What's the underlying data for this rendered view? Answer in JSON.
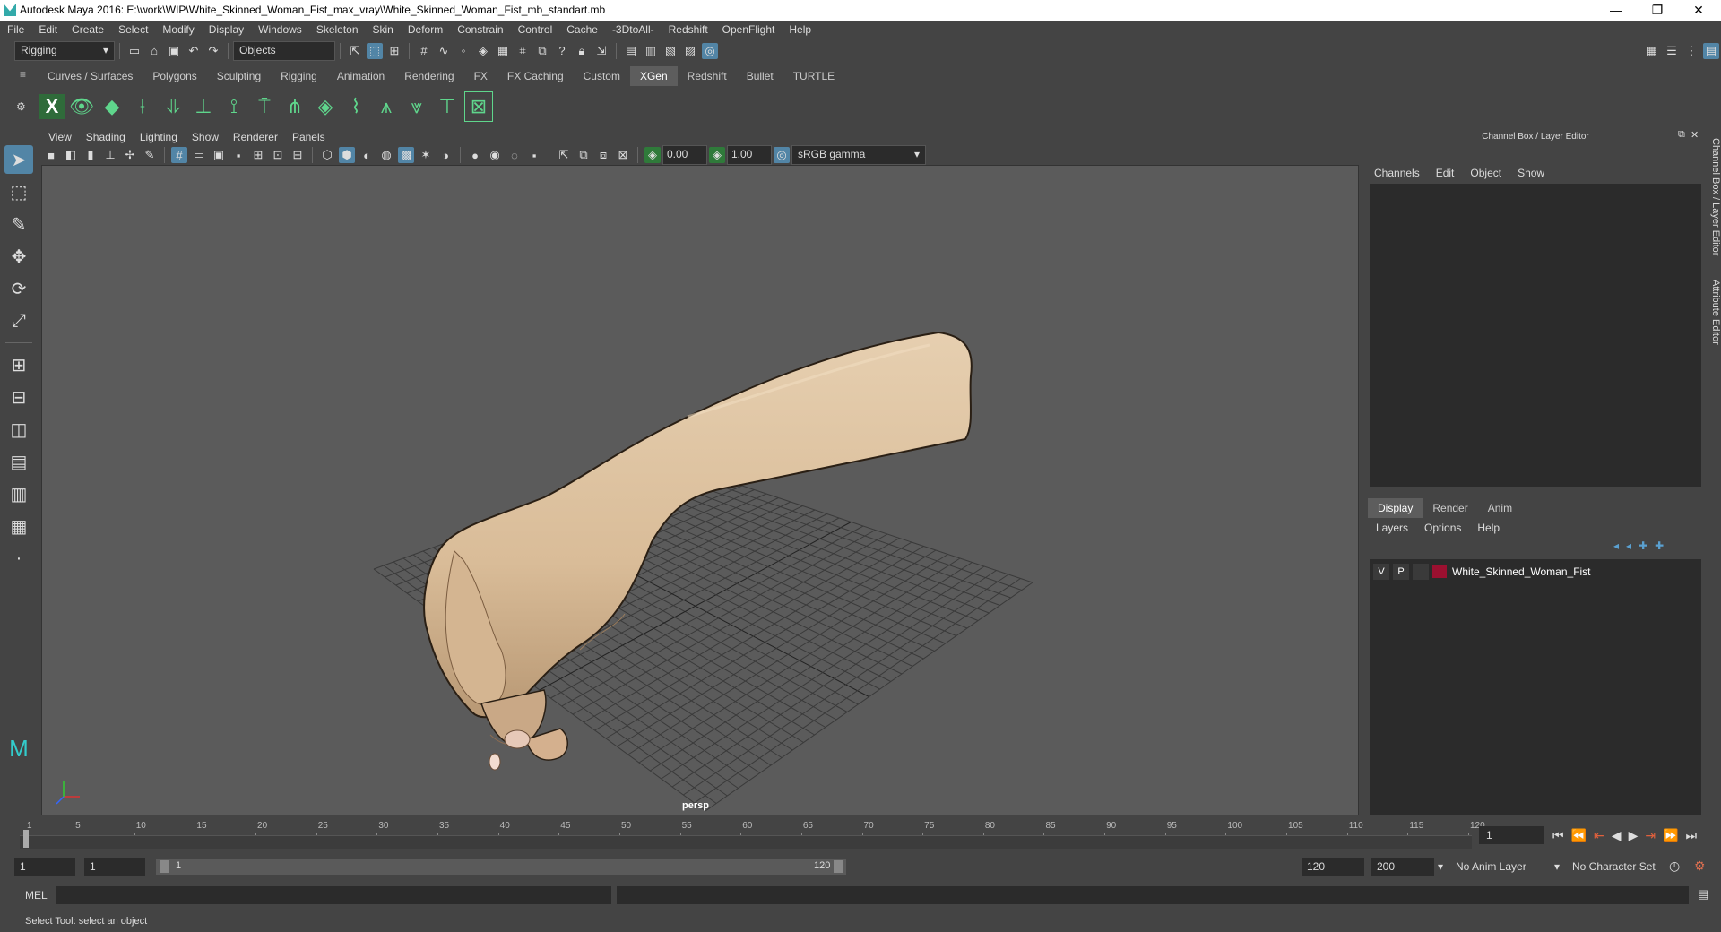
{
  "window": {
    "title": "Autodesk Maya 2016: E:\\work\\WIP\\White_Skinned_Woman_Fist_max_vray\\White_Skinned_Woman_Fist_mb_standart.mb",
    "minimize": "—",
    "restore": "❐",
    "close": "✕"
  },
  "menubar": [
    "File",
    "Edit",
    "Create",
    "Select",
    "Modify",
    "Display",
    "Windows",
    "Skeleton",
    "Skin",
    "Deform",
    "Constrain",
    "Control",
    "Cache",
    "-3DtoAll-",
    "Redshift",
    "OpenFlight",
    "Help"
  ],
  "statusline": {
    "mode": "Rigging",
    "selection_mask": "Objects"
  },
  "shelf_tabs": [
    "Curves / Surfaces",
    "Polygons",
    "Sculpting",
    "Rigging",
    "Animation",
    "Rendering",
    "FX",
    "FX Caching",
    "Custom",
    "XGen",
    "Redshift",
    "Bullet",
    "TURTLE"
  ],
  "active_shelf_tab": "XGen",
  "viewport": {
    "menu": [
      "View",
      "Shading",
      "Lighting",
      "Show",
      "Renderer",
      "Panels"
    ],
    "exposure": "0.00",
    "gamma": "1.00",
    "color_space": "sRGB gamma",
    "camera": "persp"
  },
  "channel_box": {
    "header": "Channel Box / Layer Editor",
    "menu": [
      "Channels",
      "Edit",
      "Object",
      "Show"
    ]
  },
  "layer_editor": {
    "tabs": [
      "Display",
      "Render",
      "Anim"
    ],
    "active_tab": "Display",
    "menu": [
      "Layers",
      "Options",
      "Help"
    ],
    "layers": [
      {
        "visible": "V",
        "playback": "P",
        "name": "White_Skinned_Woman_Fist",
        "color": "#9b1030"
      }
    ]
  },
  "side_tabs": [
    "Channel Box / Layer Editor",
    "Attribute Editor"
  ],
  "timeline": {
    "ticks": [
      "1",
      "5",
      "10",
      "15",
      "20",
      "25",
      "30",
      "35",
      "40",
      "45",
      "50",
      "55",
      "60",
      "65",
      "70",
      "75",
      "80",
      "85",
      "90",
      "95",
      "100",
      "105",
      "110",
      "115",
      "120"
    ],
    "current_frame": "1"
  },
  "range": {
    "start": "1",
    "playback_start": "1",
    "slider_start": "1",
    "slider_end": "120",
    "playback_end": "120",
    "end": "200",
    "anim_layer": "No Anim Layer",
    "character_set": "No Character Set"
  },
  "command_line": {
    "label": "MEL"
  },
  "help_line": "Select Tool: select an object",
  "icons": {
    "select_tool": "arrow-icon",
    "lasso_tool": "lasso-icon",
    "paint_tool": "brush-icon",
    "move_tool": "move-icon",
    "rotate_tool": "rotate-icon",
    "scale_tool": "scale-icon"
  }
}
